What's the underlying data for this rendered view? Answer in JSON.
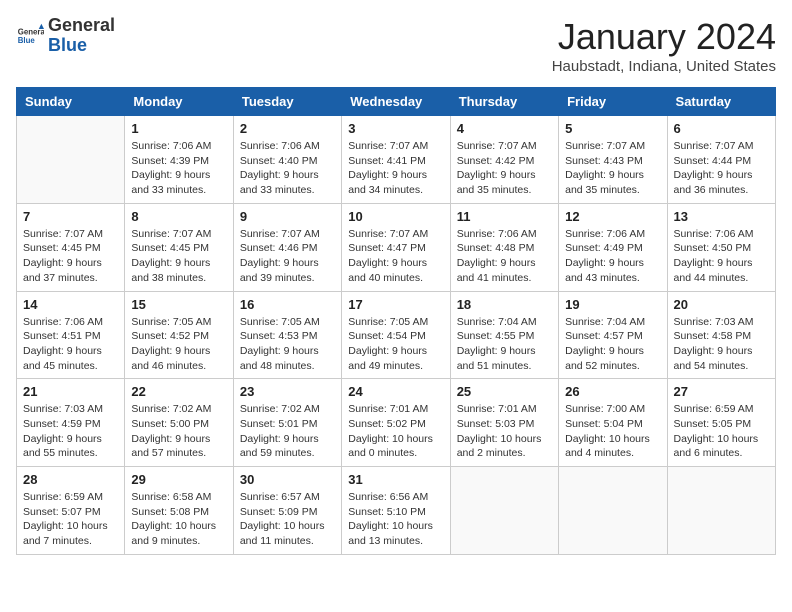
{
  "logo": {
    "general": "General",
    "blue": "Blue"
  },
  "header": {
    "title": "January 2024",
    "subtitle": "Haubstadt, Indiana, United States"
  },
  "weekdays": [
    "Sunday",
    "Monday",
    "Tuesday",
    "Wednesday",
    "Thursday",
    "Friday",
    "Saturday"
  ],
  "weeks": [
    [
      {
        "day": "",
        "info": ""
      },
      {
        "day": "1",
        "info": "Sunrise: 7:06 AM\nSunset: 4:39 PM\nDaylight: 9 hours\nand 33 minutes."
      },
      {
        "day": "2",
        "info": "Sunrise: 7:06 AM\nSunset: 4:40 PM\nDaylight: 9 hours\nand 33 minutes."
      },
      {
        "day": "3",
        "info": "Sunrise: 7:07 AM\nSunset: 4:41 PM\nDaylight: 9 hours\nand 34 minutes."
      },
      {
        "day": "4",
        "info": "Sunrise: 7:07 AM\nSunset: 4:42 PM\nDaylight: 9 hours\nand 35 minutes."
      },
      {
        "day": "5",
        "info": "Sunrise: 7:07 AM\nSunset: 4:43 PM\nDaylight: 9 hours\nand 35 minutes."
      },
      {
        "day": "6",
        "info": "Sunrise: 7:07 AM\nSunset: 4:44 PM\nDaylight: 9 hours\nand 36 minutes."
      }
    ],
    [
      {
        "day": "7",
        "info": "Sunrise: 7:07 AM\nSunset: 4:45 PM\nDaylight: 9 hours\nand 37 minutes."
      },
      {
        "day": "8",
        "info": "Sunrise: 7:07 AM\nSunset: 4:45 PM\nDaylight: 9 hours\nand 38 minutes."
      },
      {
        "day": "9",
        "info": "Sunrise: 7:07 AM\nSunset: 4:46 PM\nDaylight: 9 hours\nand 39 minutes."
      },
      {
        "day": "10",
        "info": "Sunrise: 7:07 AM\nSunset: 4:47 PM\nDaylight: 9 hours\nand 40 minutes."
      },
      {
        "day": "11",
        "info": "Sunrise: 7:06 AM\nSunset: 4:48 PM\nDaylight: 9 hours\nand 41 minutes."
      },
      {
        "day": "12",
        "info": "Sunrise: 7:06 AM\nSunset: 4:49 PM\nDaylight: 9 hours\nand 43 minutes."
      },
      {
        "day": "13",
        "info": "Sunrise: 7:06 AM\nSunset: 4:50 PM\nDaylight: 9 hours\nand 44 minutes."
      }
    ],
    [
      {
        "day": "14",
        "info": "Sunrise: 7:06 AM\nSunset: 4:51 PM\nDaylight: 9 hours\nand 45 minutes."
      },
      {
        "day": "15",
        "info": "Sunrise: 7:05 AM\nSunset: 4:52 PM\nDaylight: 9 hours\nand 46 minutes."
      },
      {
        "day": "16",
        "info": "Sunrise: 7:05 AM\nSunset: 4:53 PM\nDaylight: 9 hours\nand 48 minutes."
      },
      {
        "day": "17",
        "info": "Sunrise: 7:05 AM\nSunset: 4:54 PM\nDaylight: 9 hours\nand 49 minutes."
      },
      {
        "day": "18",
        "info": "Sunrise: 7:04 AM\nSunset: 4:55 PM\nDaylight: 9 hours\nand 51 minutes."
      },
      {
        "day": "19",
        "info": "Sunrise: 7:04 AM\nSunset: 4:57 PM\nDaylight: 9 hours\nand 52 minutes."
      },
      {
        "day": "20",
        "info": "Sunrise: 7:03 AM\nSunset: 4:58 PM\nDaylight: 9 hours\nand 54 minutes."
      }
    ],
    [
      {
        "day": "21",
        "info": "Sunrise: 7:03 AM\nSunset: 4:59 PM\nDaylight: 9 hours\nand 55 minutes."
      },
      {
        "day": "22",
        "info": "Sunrise: 7:02 AM\nSunset: 5:00 PM\nDaylight: 9 hours\nand 57 minutes."
      },
      {
        "day": "23",
        "info": "Sunrise: 7:02 AM\nSunset: 5:01 PM\nDaylight: 9 hours\nand 59 minutes."
      },
      {
        "day": "24",
        "info": "Sunrise: 7:01 AM\nSunset: 5:02 PM\nDaylight: 10 hours\nand 0 minutes."
      },
      {
        "day": "25",
        "info": "Sunrise: 7:01 AM\nSunset: 5:03 PM\nDaylight: 10 hours\nand 2 minutes."
      },
      {
        "day": "26",
        "info": "Sunrise: 7:00 AM\nSunset: 5:04 PM\nDaylight: 10 hours\nand 4 minutes."
      },
      {
        "day": "27",
        "info": "Sunrise: 6:59 AM\nSunset: 5:05 PM\nDaylight: 10 hours\nand 6 minutes."
      }
    ],
    [
      {
        "day": "28",
        "info": "Sunrise: 6:59 AM\nSunset: 5:07 PM\nDaylight: 10 hours\nand 7 minutes."
      },
      {
        "day": "29",
        "info": "Sunrise: 6:58 AM\nSunset: 5:08 PM\nDaylight: 10 hours\nand 9 minutes."
      },
      {
        "day": "30",
        "info": "Sunrise: 6:57 AM\nSunset: 5:09 PM\nDaylight: 10 hours\nand 11 minutes."
      },
      {
        "day": "31",
        "info": "Sunrise: 6:56 AM\nSunset: 5:10 PM\nDaylight: 10 hours\nand 13 minutes."
      },
      {
        "day": "",
        "info": ""
      },
      {
        "day": "",
        "info": ""
      },
      {
        "day": "",
        "info": ""
      }
    ]
  ]
}
